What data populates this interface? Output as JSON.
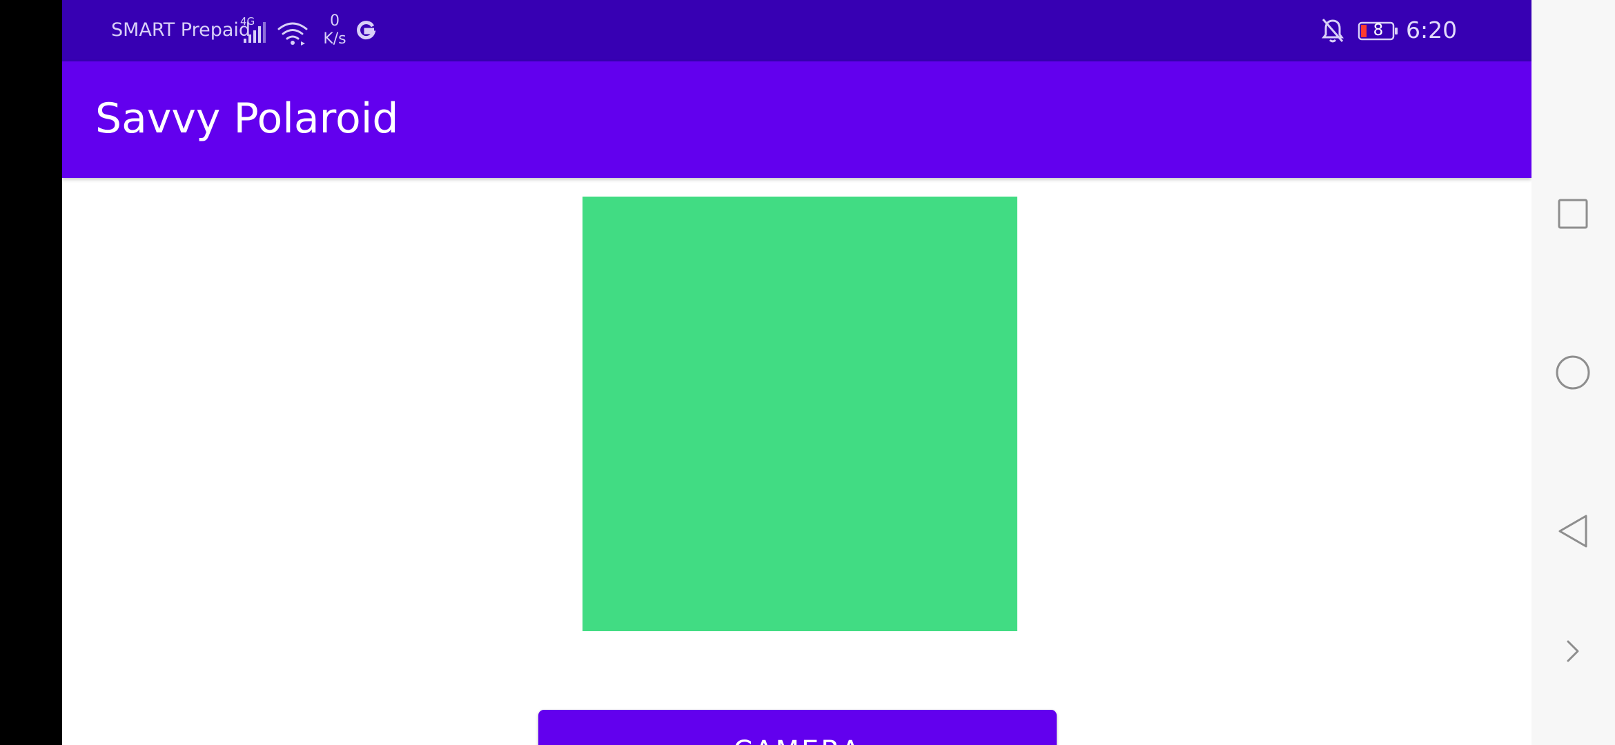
{
  "status_bar": {
    "carrier": "SMART Prepaid",
    "network_type": "4G",
    "net_speed_value": "0",
    "net_speed_unit": "K/s",
    "battery_level": "8",
    "time": "6:20",
    "icons": [
      "signal-icon",
      "wifi-icon",
      "google-icon",
      "notifications-off-icon",
      "battery-icon"
    ]
  },
  "app_bar": {
    "title": "Savvy Polaroid"
  },
  "main": {
    "preview_color": "#41dc83",
    "camera_button_label": "CAMERA"
  },
  "nav_bar": {
    "buttons": [
      "recents-button",
      "home-button",
      "back-button",
      "more-button"
    ]
  },
  "colors": {
    "status_bar": "#3700b3",
    "primary": "#6200ee",
    "preview_green": "#41dc83"
  }
}
